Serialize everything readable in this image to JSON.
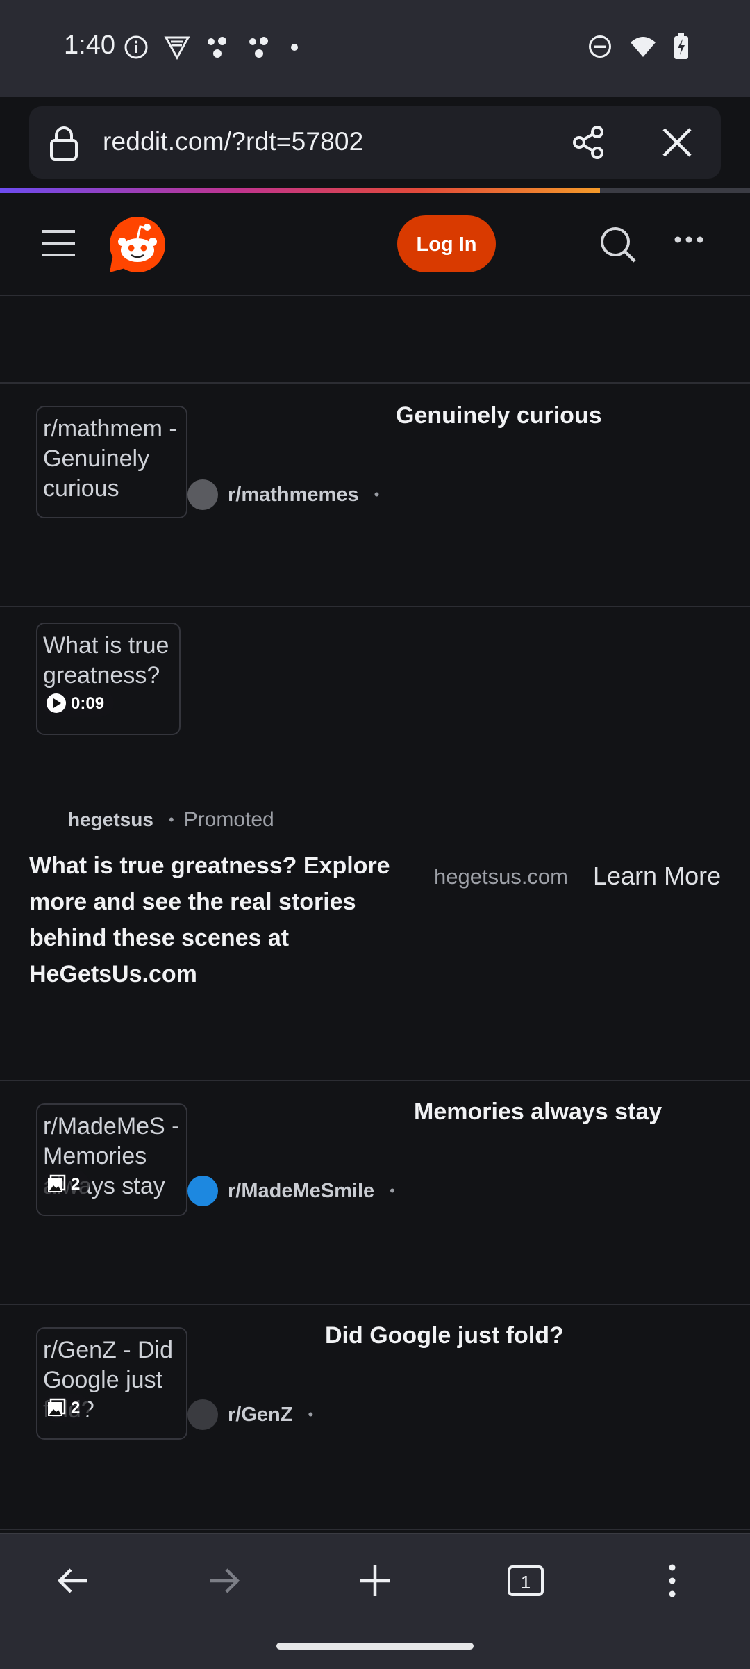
{
  "status_bar": {
    "time": "1:40",
    "left_icons": [
      "info-icon",
      "vpn-icon",
      "assistant-icon",
      "assistant-icon",
      "dot-icon"
    ],
    "right_icons": [
      "do-not-disturb-icon",
      "wifi-icon",
      "battery-charging-icon"
    ]
  },
  "browser": {
    "url": "reddit.com/?rdt=57802",
    "load_progress": 0.8
  },
  "header": {
    "login_label": "Log In"
  },
  "posts": [
    {
      "thumb_text": "r/mathmem - Genuinely curious",
      "title": "Genuinely curious",
      "subreddit": "r/mathmemes",
      "avatar_color": "#5a5b60",
      "dot": "•"
    },
    {
      "thumb_text": "What is true greatness?",
      "video_duration": "0:09",
      "user": "hegetsus",
      "dot": "•",
      "promoted_label": "Promoted",
      "title": "What is true greatness? Explore more and see the real stories behind these scenes at HeGetsUs.com",
      "domain": "hegetsus.com",
      "cta": "Learn More"
    },
    {
      "thumb_text": "r/MadeMeS - Memories always stay",
      "gallery_count": "2",
      "title": "Memories always stay",
      "subreddit": "r/MadeMeSmile",
      "avatar_color": "#1d88e0",
      "dot": "•"
    },
    {
      "thumb_text": "r/GenZ - Did Google just fold?",
      "gallery_count": "2",
      "title": "Did Google just fold?",
      "subreddit": "r/GenZ",
      "avatar_color": "#3a3b40",
      "dot": "•"
    }
  ],
  "bottom_nav": {
    "tab_count": "1",
    "items": [
      "back-icon",
      "forward-icon",
      "new-tab-icon",
      "tab-switcher-icon",
      "menu-icon"
    ]
  },
  "colors": {
    "background": "#121316",
    "chrome": "#2a2b33",
    "reddit_orange": "#d93a00"
  }
}
